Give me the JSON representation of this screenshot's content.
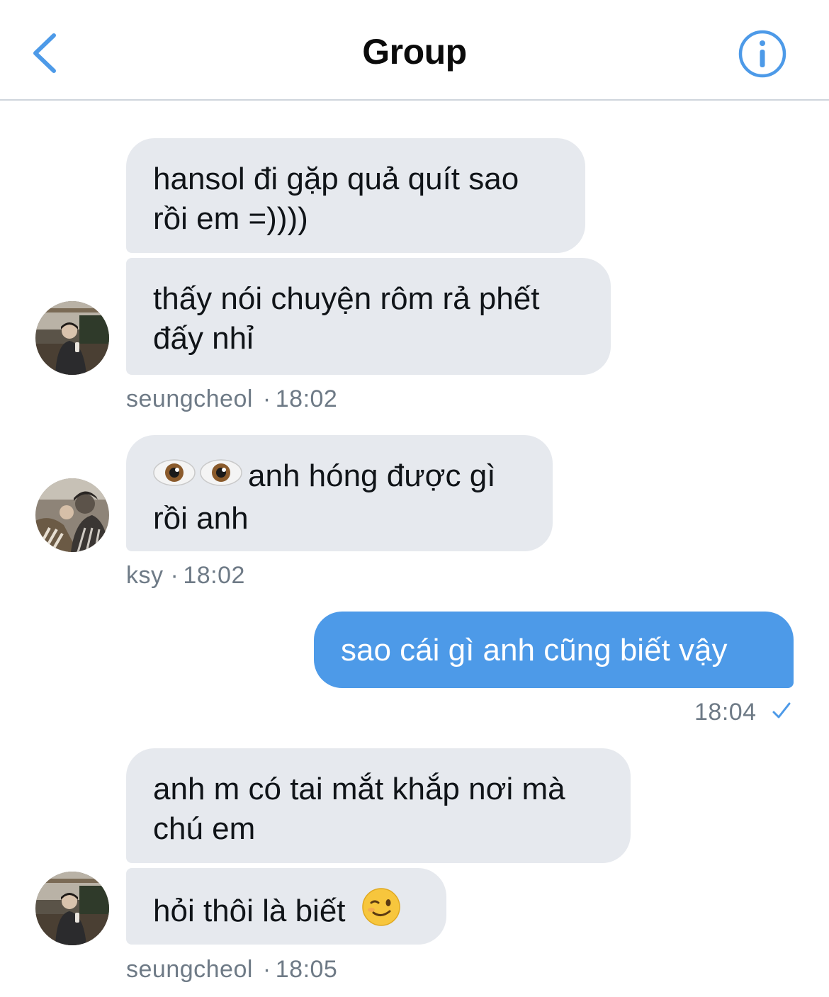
{
  "header": {
    "title": "Group",
    "back_icon": "chevron-left-icon",
    "info_icon": "info-circle-icon",
    "accent": "#4d9ae8"
  },
  "messages": [
    {
      "sender": "seungcheol",
      "text": "hansol đi gặp quả quít sao rồi em =))))"
    },
    {
      "sender": "seungcheol",
      "text": "thấy nói chuyện rôm rả phết đấy nhỉ"
    },
    {
      "sender": "seungcheol",
      "time": "18:02",
      "separator": "·"
    },
    {
      "sender": "ksy",
      "text": "anh hóng được gì rồi anh",
      "emoji": "eyes-emoji"
    },
    {
      "sender": "ksy",
      "time": "18:02",
      "separator": "·"
    },
    {
      "sender": "me",
      "text": "sao cái gì anh cũng biết vậy",
      "time": "18:04",
      "status_icon": "check-icon"
    },
    {
      "sender": "seungcheol",
      "text": "anh m có tai mắt khắp nơi mà chú em"
    },
    {
      "sender": "seungcheol",
      "text": "hỏi thôi là biết",
      "emoji": "winking-face-emoji"
    },
    {
      "sender": "seungcheol",
      "time": "18:05",
      "separator": "·"
    }
  ],
  "labels": {
    "m1_line1": "hansol đi gặp quả quít sao",
    "m1_line2": "rồi em =))))",
    "m2_line1": "thấy nói chuyện rôm rả phết",
    "m2_line2": "đấy nhỉ",
    "meta1_name": "seungcheol",
    "meta1_time": "18:02",
    "m3_line1": "anh hóng được gì",
    "m3_line2": "rồi anh",
    "meta2_name": "ksy",
    "meta2_time": "18:02",
    "m4_text": "sao cái gì anh cũng biết vậy",
    "meta3_time": "18:04",
    "m5_line1": "anh m có tai mắt khắp nơi mà",
    "m5_line2": "chú em",
    "m6_text": "hỏi thôi là biết",
    "meta4_name": "seungcheol",
    "meta4_time": "18:05",
    "dot": "·"
  }
}
